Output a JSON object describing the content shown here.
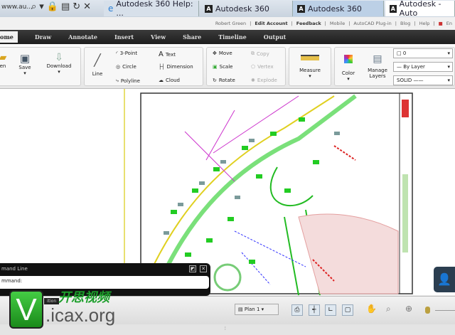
{
  "browser": {
    "address": "www.au...",
    "tabs": [
      "Autodesk 360 Help: ...",
      "Autodesk 360",
      "Autodesk 360",
      "Autodesk - Auto"
    ]
  },
  "links": {
    "user": "Robert Green",
    "items": [
      "Edit Account",
      "Feedback",
      "Mobile",
      "AutoCAD Plug-in",
      "Blog",
      "Help"
    ],
    "lang": "En"
  },
  "ribbon_tabs": [
    "ome",
    "Draw",
    "Annotate",
    "Insert",
    "View",
    "Share",
    "Timeline",
    "Output"
  ],
  "ribbon": {
    "open": "en",
    "save": "Save",
    "download": "Download",
    "line": "Line",
    "arc": "3-Point",
    "circle": "Circle",
    "polyline": "Polyline",
    "text": "Text",
    "dimension": "Dimension",
    "cloud": "Cloud",
    "move": "Move",
    "scale": "Scale",
    "rotate": "Rotate",
    "copy": "Copy",
    "vertex": "Vertex",
    "explode": "Explode",
    "measure": "Measure",
    "color": "Color",
    "manage_layers": "Manage Layers",
    "layer": "0",
    "linetype": "By Layer",
    "lineweight": "SOLID"
  },
  "command": {
    "title": "mand Line",
    "prompt": "mmand:",
    "under": "ition"
  },
  "status": {
    "layout": "Plan 1"
  },
  "watermark": {
    "letter": "V",
    "cn": "开思视频",
    "site": ".icax.org"
  },
  "colors": {
    "accent": "#1b9e2a"
  }
}
